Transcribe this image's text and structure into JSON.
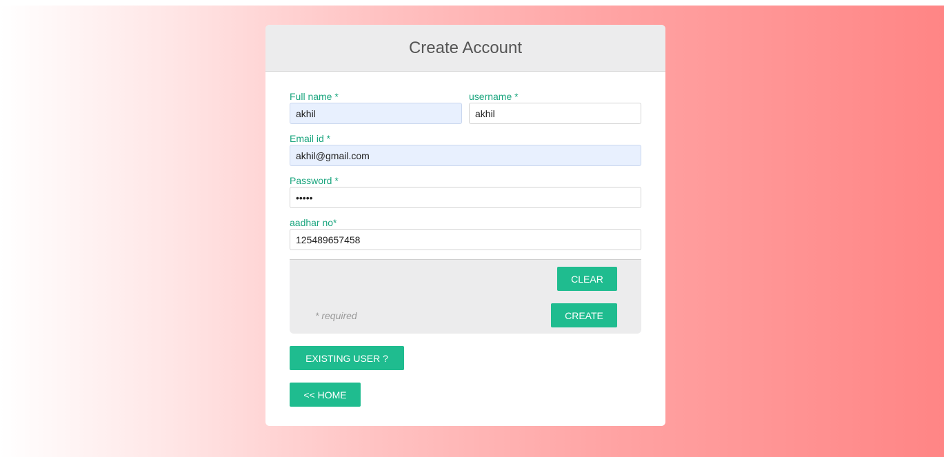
{
  "form": {
    "title": "Create Account",
    "fullname": {
      "label": "Full name *",
      "value": "akhil"
    },
    "username": {
      "label": "username *",
      "value": "akhil"
    },
    "email": {
      "label": "Email id *",
      "value": "akhil@gmail.com"
    },
    "password": {
      "label": "Password *",
      "value": "akhil"
    },
    "aadhar": {
      "label": "aadhar no*",
      "value": "125489657458"
    }
  },
  "actions": {
    "clear_label": "CLEAR",
    "create_label": "CREATE",
    "required_note": "* required",
    "existing_user_label": "EXISTING USER ?",
    "home_label": "<< HOME"
  },
  "colors": {
    "accent": "#1fbc8f",
    "label": "#1aa57e",
    "autofill_bg": "#e8f0fe",
    "gradient_end": "#ff8585"
  }
}
